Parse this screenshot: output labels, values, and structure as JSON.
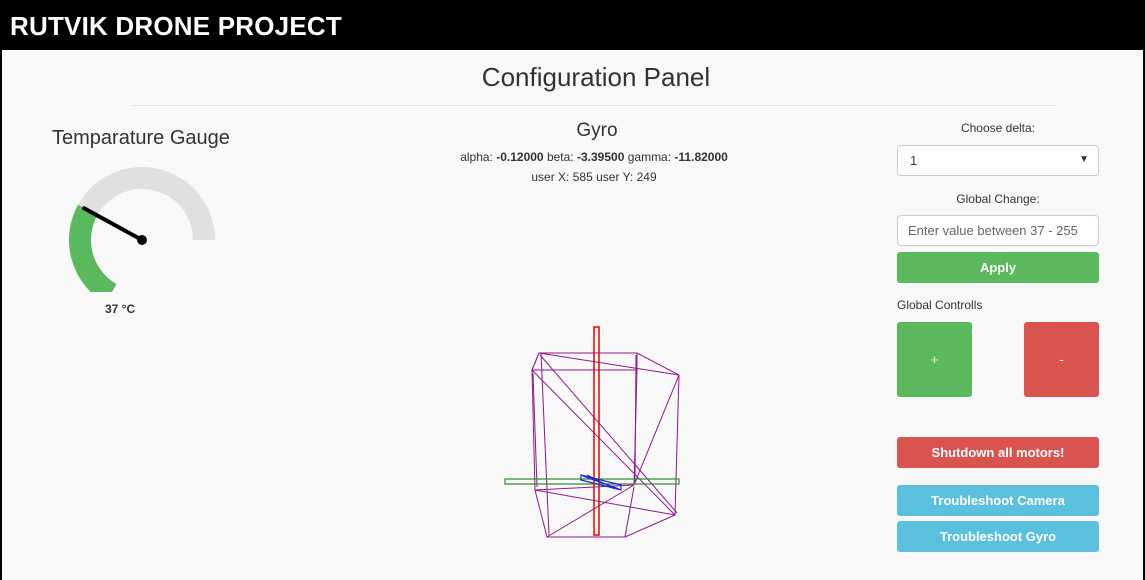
{
  "header": {
    "brand": "RUTVIK DRONE PROJECT"
  },
  "page": {
    "title": "Configuration Panel"
  },
  "gauge": {
    "heading": "Temparature Gauge",
    "value": 37,
    "min": 0,
    "max": 100,
    "value_text": "37 °C",
    "fill_color": "#5cb85c",
    "track_color": "#e0e0e0"
  },
  "gyro": {
    "heading": "Gyro",
    "alpha_label": "alpha:",
    "alpha_value": "-0.12000",
    "beta_label": "beta:",
    "beta_value": "-3.39500",
    "gamma_label": "gamma:",
    "gamma_value": "-11.82000",
    "user_x_label": "user X:",
    "user_x_value": "585",
    "user_y_label": "user Y:",
    "user_y_value": "249"
  },
  "controls": {
    "delta_label": "Choose delta:",
    "delta_selected": "1",
    "global_change_label": "Global Change:",
    "global_change_placeholder": "Enter value between 37 - 255",
    "apply_label": "Apply",
    "global_controls_label": "Global Controlls",
    "plus_label": "+",
    "minus_label": "-",
    "shutdown_label": "Shutdown all motors!",
    "troubleshoot_camera_label": "Troubleshoot Camera",
    "troubleshoot_gyro_label": "Troubleshoot Gyro"
  },
  "colors": {
    "success": "#5cb85c",
    "danger": "#d9534f",
    "info": "#5bc0de"
  }
}
